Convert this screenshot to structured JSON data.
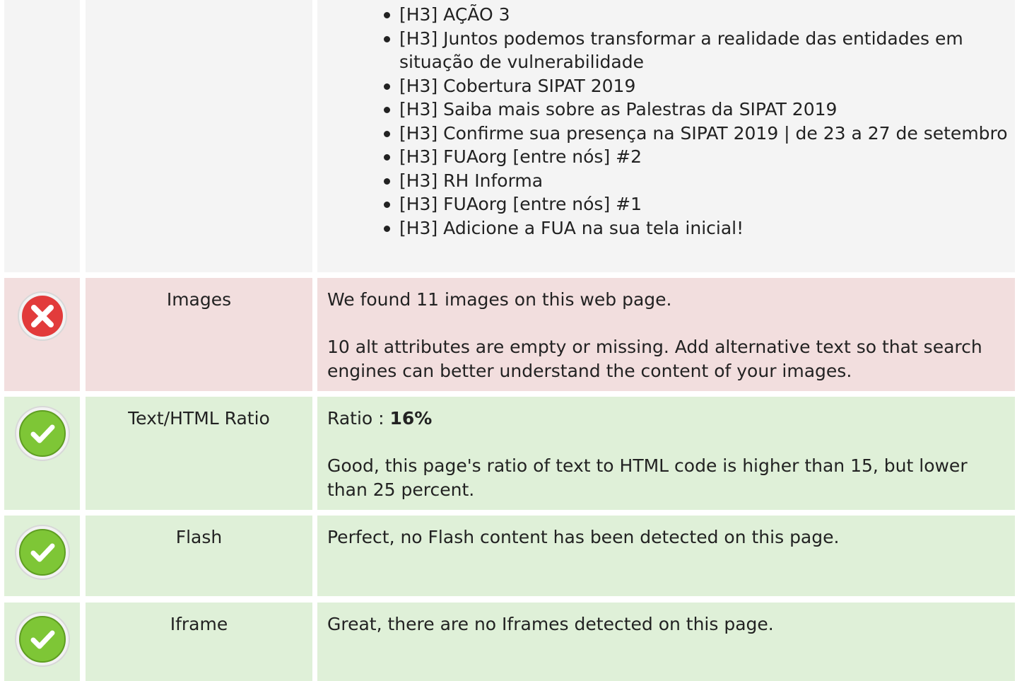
{
  "colors": {
    "neutral_row": "#f4f4f4",
    "error_row": "#f2dede",
    "success_row": "#dff0d8",
    "error_icon": "#e23b3b",
    "success_icon": "#7ec636"
  },
  "headings": {
    "items": [
      "[H3] AÇÃO 3",
      "[H3] Juntos podemos transformar a realidade das entidades em situação de vulnerabilidade",
      "[H3] Cobertura SIPAT 2019",
      "[H3] Saiba mais sobre as Palestras da SIPAT 2019",
      "[H3] Confirme sua presença na SIPAT 2019 | de 23 a 27 de setembro",
      "[H3] FUAorg [entre nós] #2",
      "[H3] RH Informa",
      "[H3] FUAorg [entre nós] #1",
      "[H3] Adicione a FUA na sua tela inicial!"
    ]
  },
  "rows": {
    "images": {
      "status_icon": "error-icon",
      "label": "Images",
      "line1": "We found 11 images on this web page.",
      "line2": "10 alt attributes are empty or missing. Add alternative text so that search engines can better understand the content of your images."
    },
    "ratio": {
      "status_icon": "success-check-icon",
      "label": "Text/HTML Ratio",
      "ratio_prefix": "Ratio : ",
      "ratio_value": "16%",
      "line2": "Good, this page's ratio of text to HTML code is higher than 15, but lower than 25 percent."
    },
    "flash": {
      "status_icon": "success-check-icon",
      "label": "Flash",
      "line1": "Perfect, no Flash content has been detected on this page."
    },
    "iframe": {
      "status_icon": "success-check-icon",
      "label": "Iframe",
      "line1": "Great, there are no Iframes detected on this page."
    }
  }
}
